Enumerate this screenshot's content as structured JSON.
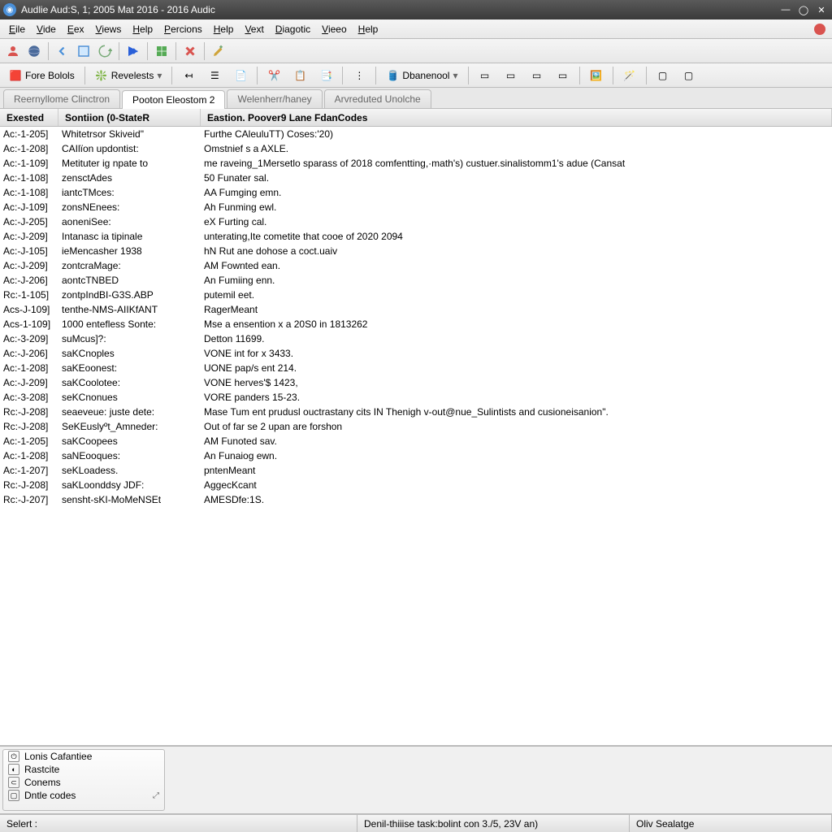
{
  "window": {
    "title": "Audlie Aud:S, 1; 2005 Mat 2016 - 2016 Audic"
  },
  "menu": [
    {
      "label": "Eile",
      "u": "E"
    },
    {
      "label": "Vide",
      "u": "V"
    },
    {
      "label": "Eex",
      "u": "E"
    },
    {
      "label": "Views",
      "u": "V"
    },
    {
      "label": "Help",
      "u": "H"
    },
    {
      "label": "Percions",
      "u": "P"
    },
    {
      "label": "Help",
      "u": "H"
    },
    {
      "label": "Vext",
      "u": "V"
    },
    {
      "label": "Diagotic",
      "u": "D"
    },
    {
      "label": "Vieeo",
      "u": "V"
    },
    {
      "label": "Help",
      "u": "H"
    }
  ],
  "toolbar2": {
    "btn1": "Fore Bolols",
    "btn2": "Revelests",
    "btn3": "Dbanenool"
  },
  "tabs": [
    {
      "label": "Reernyllome Clinctron",
      "active": false
    },
    {
      "label": "Pooton Eleostom 2",
      "active": true
    },
    {
      "label": "Welenherr/haney",
      "active": false
    },
    {
      "label": "Arvreduted Unolche",
      "active": false
    }
  ],
  "columns": {
    "c1": "Exested",
    "c2": "Sontiion (0-StateR",
    "c3": "Eastion. Poover9 Lane FdanCodes"
  },
  "rows": [
    {
      "c1": "Ac:-1-205]",
      "c2": "Whitetrsor Skiveid\"",
      "c3": "Furthe CAleuluTT) Coses:'20)"
    },
    {
      "c1": "Ac:-1-208]",
      "c2": "CAIlïon updontist:",
      "c3": "Omstnief s a AXLE."
    },
    {
      "c1": "Ac:-1-109]",
      "c2": "Metituter ig npate to",
      "c3": "me raveing_1Mersetlo sparass of 2018 comfentting,·math's) custuer.sinalistomm1's adue (Cansat"
    },
    {
      "c1": "Ac:-1-108]",
      "c2": "zensctAdes",
      "c3": "50 Funater sal."
    },
    {
      "c1": "Ac:-1-108]",
      "c2": "iantcTMces:",
      "c3": "AA Fumging emn."
    },
    {
      "c1": "Ac:-J-109]",
      "c2": "zonsNEnees:",
      "c3": "Ah Funming ewl."
    },
    {
      "c1": "Ac:-J-205]",
      "c2": "aoneniSee:",
      "c3": "eX Furting cal."
    },
    {
      "c1": "Ac:-J-209]",
      "c2": "Intanasc ia tipinale",
      "c3": "unterating,Ite cometite that cooe of 2020 2094"
    },
    {
      "c1": "Ac:-J-105]",
      "c2": "ieMencasher 1938",
      "c3": "hN Rut ane dohose a coct.uaiv"
    },
    {
      "c1": "Ac:-J-209]",
      "c2": "zontcraMage:",
      "c3": "AM Fownted ean."
    },
    {
      "c1": "Ac:-J-206]",
      "c2": "aontcTNBED",
      "c3": "An Fumiing enn."
    },
    {
      "c1": "Rc:-1-105]",
      "c2": "zontpIndBI-G3S.ABP",
      "c3": "putemil eet."
    },
    {
      "c1": "Acs-J-109]",
      "c2": "tenthe-NMS-AIIKfANT",
      "c3": "RagerMeant"
    },
    {
      "c1": "Acs-1-109]",
      "c2": "1000 entefless Sonte:",
      "c3": "Mse a ensention x a 20S0 in 1813262"
    },
    {
      "c1": "Ac:-3-209]",
      "c2": "suMcus]?:",
      "c3": "Detton 11699."
    },
    {
      "c1": "Ac:-J-206]",
      "c2": "saKCnoples",
      "c3": "VONE int for x 3433."
    },
    {
      "c1": "Ac:-1-208]",
      "c2": "saKEoonest:",
      "c3": "UONE pap/s ent 214."
    },
    {
      "c1": "Ac:-J-209]",
      "c2": "saKCoolotee:",
      "c3": "VONE herves'$ 1423,"
    },
    {
      "c1": "Ac:-3-208]",
      "c2": "seKCnonues",
      "c3": "VORE panders 15-23."
    },
    {
      "c1": "Rc:-J-208]",
      "c2": "seaeveue: juste dete:",
      "c3": "Mase Tum ent prudusl ouctrastany cits IN Thenigh v-out@nue_Sulintists and cusioneisanion\"."
    },
    {
      "c1": "Rc:-J-208]",
      "c2": "SeKEuslyºt_Amneder:",
      "c3": "Out of far se 2 upan are forshon"
    },
    {
      "c1": "Ac:-1-205]",
      "c2": "saKCoopees",
      "c3": "AM Funoted sav."
    },
    {
      "c1": "Ac:-1-208]",
      "c2": "saNEooques:",
      "c3": "An Funaiog ewn."
    },
    {
      "c1": "Ac:-1-207]",
      "c2": "seKLoadess.",
      "c3": "pntenMeant"
    },
    {
      "c1": "Rc:-J-208]",
      "c2": "saKLoonddsy JDF:",
      "c3": "AggecKcant"
    },
    {
      "c1": "Rc:-J-207]",
      "c2": "sensht-sKI-MoMeNSEt",
      "c3": "AMESDfe:1S."
    }
  ],
  "bottom": [
    {
      "label": "Lonis Cafantiee"
    },
    {
      "label": "Rastcite"
    },
    {
      "label": "Conems"
    },
    {
      "label": "Dntle codes"
    }
  ],
  "status": {
    "s1": "Selert :",
    "s2": "Denil-thiiise task:bolint con 3./5, 23V an)",
    "s3": "Oliv Sealatge"
  }
}
